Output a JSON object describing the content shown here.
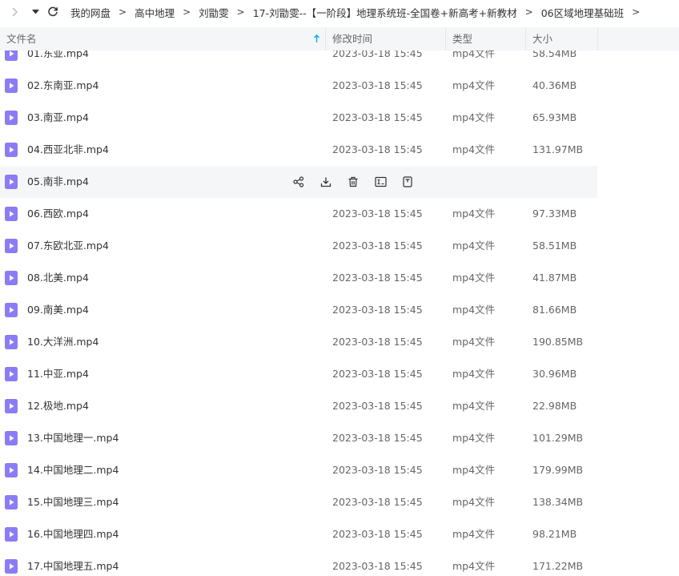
{
  "breadcrumb": [
    "我的网盘",
    "高中地理",
    "刘勖雯",
    "17-刘勖雯--【一阶段】地理系统班-全国卷+新高考+新教材",
    "06区域地理基础班"
  ],
  "breadcrumb_sep": ">",
  "columns": {
    "name": "文件名",
    "modified": "修改时间",
    "type": "类型",
    "size": "大小"
  },
  "files": [
    {
      "name": "01.东亚.mp4",
      "modified": "2023-03-18 15:45",
      "type": "mp4文件",
      "size": "58.54MB"
    },
    {
      "name": "02.东南亚.mp4",
      "modified": "2023-03-18 15:45",
      "type": "mp4文件",
      "size": "40.36MB"
    },
    {
      "name": "03.南亚.mp4",
      "modified": "2023-03-18 15:45",
      "type": "mp4文件",
      "size": "65.93MB"
    },
    {
      "name": "04.西亚北非.mp4",
      "modified": "2023-03-18 15:45",
      "type": "mp4文件",
      "size": "131.97MB"
    },
    {
      "name": "05.南非.mp4",
      "modified": "",
      "type": "",
      "size": "",
      "hovered": true
    },
    {
      "name": "06.西欧.mp4",
      "modified": "2023-03-18 15:45",
      "type": "mp4文件",
      "size": "97.33MB"
    },
    {
      "name": "07.东欧北亚.mp4",
      "modified": "2023-03-18 15:45",
      "type": "mp4文件",
      "size": "58.51MB"
    },
    {
      "name": "08.北美.mp4",
      "modified": "2023-03-18 15:45",
      "type": "mp4文件",
      "size": "41.87MB"
    },
    {
      "name": "09.南美.mp4",
      "modified": "2023-03-18 15:45",
      "type": "mp4文件",
      "size": "81.66MB"
    },
    {
      "name": "10.大洋洲.mp4",
      "modified": "2023-03-18 15:45",
      "type": "mp4文件",
      "size": "190.85MB"
    },
    {
      "name": "11.中亚.mp4",
      "modified": "2023-03-18 15:45",
      "type": "mp4文件",
      "size": "30.96MB"
    },
    {
      "name": "12.极地.mp4",
      "modified": "2023-03-18 15:45",
      "type": "mp4文件",
      "size": "22.98MB"
    },
    {
      "name": "13.中国地理一.mp4",
      "modified": "2023-03-18 15:45",
      "type": "mp4文件",
      "size": "101.29MB"
    },
    {
      "name": "14.中国地理二.mp4",
      "modified": "2023-03-18 15:45",
      "type": "mp4文件",
      "size": "179.99MB"
    },
    {
      "name": "15.中国地理三.mp4",
      "modified": "2023-03-18 15:45",
      "type": "mp4文件",
      "size": "138.34MB"
    },
    {
      "name": "16.中国地理四.mp4",
      "modified": "2023-03-18 15:45",
      "type": "mp4文件",
      "size": "98.21MB"
    },
    {
      "name": "17.中国地理五.mp4",
      "modified": "2023-03-18 15:45",
      "type": "mp4文件",
      "size": "171.22MB"
    }
  ],
  "colors": {
    "accent": "#06a7ff",
    "file_icon": "#8b7cf6",
    "hover_bg": "#f5f6f8",
    "header_bg": "#f5f6f8"
  }
}
